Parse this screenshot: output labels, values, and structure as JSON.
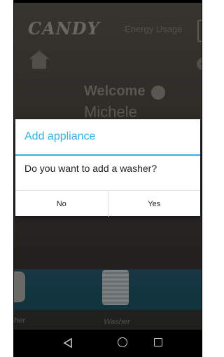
{
  "app": {
    "brand": "CANDY",
    "energy_label": "Energy Usage",
    "welcome_text": "Welcome",
    "user_name": "Michele"
  },
  "appliances": [
    {
      "label": "her"
    },
    {
      "label": "Washer"
    }
  ],
  "dialog": {
    "title": "Add appliance",
    "message": "Do you want to add a washer?",
    "no_label": "No",
    "yes_label": "Yes",
    "accent_color": "#30b3e8"
  },
  "navbar": {
    "back_icon": "back-icon",
    "home_icon": "home-icon",
    "recents_icon": "recents-icon"
  }
}
